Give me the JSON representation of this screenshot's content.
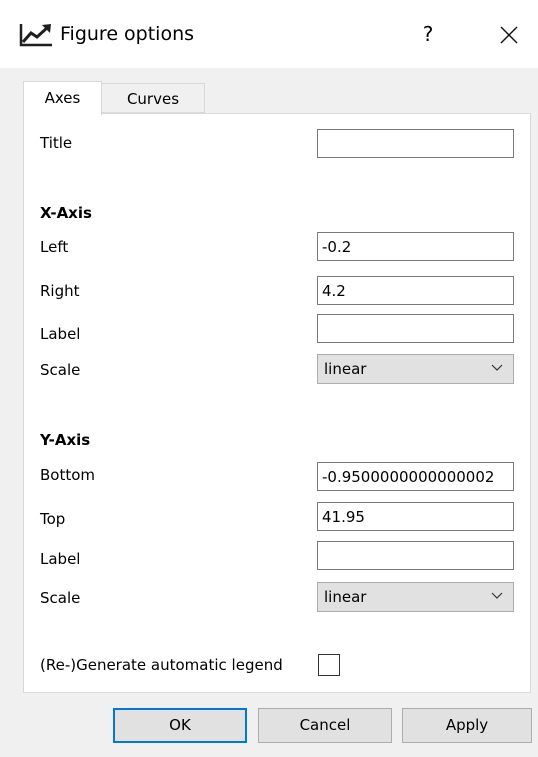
{
  "window": {
    "title": "Figure options",
    "help_label": "?",
    "icon": "line-chart-icon",
    "close_icon": "close-icon"
  },
  "tabs": [
    {
      "label": "Axes",
      "active": true
    },
    {
      "label": "Curves",
      "active": false
    }
  ],
  "axes_tab": {
    "title_label": "Title",
    "title_value": "",
    "x_axis": {
      "heading": "X-Axis",
      "left_label": "Left",
      "left_value": "-0.2",
      "right_label": "Right",
      "right_value": "4.2",
      "label_label": "Label",
      "label_value": "",
      "scale_label": "Scale",
      "scale_value": "linear"
    },
    "y_axis": {
      "heading": "Y-Axis",
      "bottom_label": "Bottom",
      "bottom_value": "-0.9500000000000002",
      "top_label": "Top",
      "top_value": "41.95",
      "label_label": "Label",
      "label_value": "",
      "scale_label": "Scale",
      "scale_value": "linear"
    },
    "legend_label": "(Re-)Generate automatic legend",
    "legend_checked": false
  },
  "buttons": {
    "ok": "OK",
    "cancel": "Cancel",
    "apply": "Apply"
  },
  "colors": {
    "accent": "#0078d7",
    "icon": "#1f1f1f"
  }
}
